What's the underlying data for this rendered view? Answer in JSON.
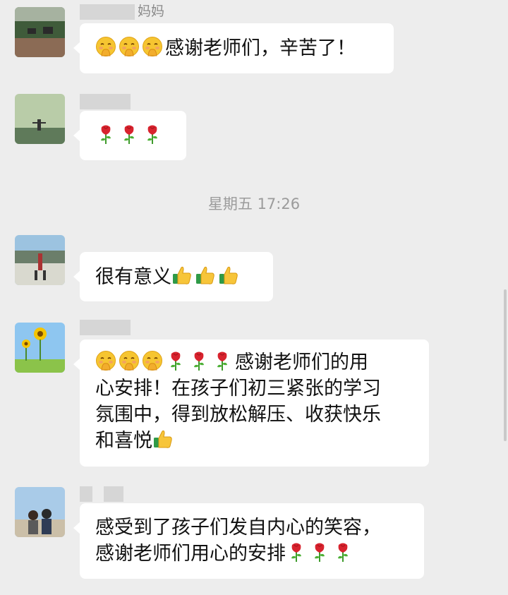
{
  "timestamp": "星期五 17:26",
  "messages": [
    {
      "sender": "妈妈",
      "text": "感谢老师们，辛苦了！",
      "emojis_before": [
        "hand-over-mouth",
        "hand-over-mouth",
        "hand-over-mouth"
      ]
    },
    {
      "sender": "",
      "text": "",
      "emojis_after": [
        "rose",
        "rose",
        "rose"
      ]
    },
    {
      "sender": "",
      "text": "很有意义",
      "emojis_after": [
        "thumbs-up",
        "thumbs-up",
        "thumbs-up"
      ]
    },
    {
      "sender": "",
      "line1": "感谢老师们的用",
      "line2": "心安排！在孩子们初三紧张的学习",
      "line3": "氛围中，得到放松解压、收获快乐",
      "line4": "和喜悦"
    },
    {
      "sender": "",
      "line1": "感受到了孩子们发自内心的笑容，",
      "line2": "感谢老师们用心的安排"
    }
  ],
  "colors": {
    "background": "#ededed",
    "bubble": "#ffffff",
    "meta_text": "#9b9b9b"
  }
}
